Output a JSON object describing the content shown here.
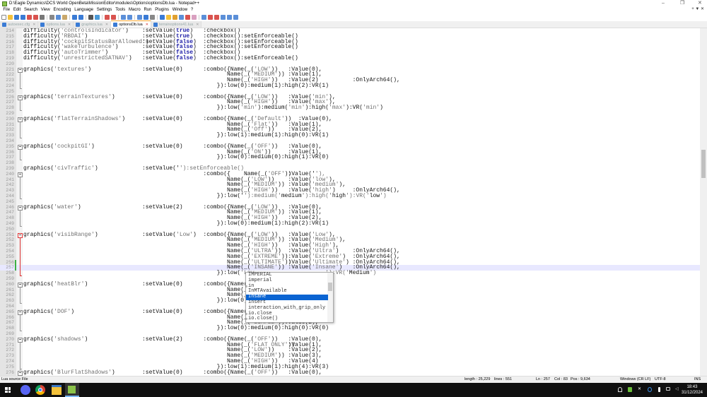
{
  "window": {
    "title": "D:\\Eagle Dynamics\\DCS World OpenBeta\\MissionEditor\\modules\\Options\\optionsDb.lua - Notepad++",
    "minimize": "–",
    "restore": "❐",
    "close": "✕"
  },
  "menu": [
    "File",
    "Edit",
    "Search",
    "View",
    "Encoding",
    "Language",
    "Settings",
    "Tools",
    "Macro",
    "Run",
    "Plugins",
    "Window",
    "?"
  ],
  "menu_right": "+ ▼ ✕",
  "tabs": [
    {
      "label": "autoexec.cfg",
      "active": false
    },
    {
      "label": "options.lua",
      "active": false
    },
    {
      "label": "graphics.lua",
      "active": false
    },
    {
      "label": "optionsDb.lua",
      "active": true
    },
    {
      "label": "terrainoptions41.lua",
      "active": false
    }
  ],
  "lines": [
    {
      "n": "214",
      "a": "difficulty('controlsIndicator')",
      "b": ":setValue(true)",
      "c": ":checkbox()"
    },
    {
      "n": "215",
      "a": "difficulty('RBDAI')",
      "b": ":setValue(true)",
      "c": ":checkbox():setEnforceable()"
    },
    {
      "n": "216",
      "a": "difficulty('cockpitStatusBarAllowed')",
      "b": ":setValue(false)",
      "c": ":checkbox():setEnforceable()"
    },
    {
      "n": "217",
      "a": "difficulty('wakeTurbulence')",
      "b": ":setValue(false)",
      "c": ":checkbox():setEnforceable()"
    },
    {
      "n": "218",
      "a": "difficulty('autoTrimmer')",
      "b": ":setValue(false)",
      "c": ":checkbox()"
    },
    {
      "n": "219",
      "a": "difficulty('unrestrictedSATNAV')",
      "b": ":setValue(false)",
      "c": ":checkbox():setEnforceable()"
    },
    {
      "n": "220"
    },
    {
      "n": "221",
      "fold": "s",
      "a": "graphics('textures')",
      "b": ":setValue(0)",
      "c": ":combo({Name(_('LOW'))",
      "f": ":Value(0),"
    },
    {
      "n": "222",
      "fold": "m",
      "e": "Name(_('MEDIUM'))",
      "f": ":Value(1),"
    },
    {
      "n": "223",
      "fold": "m",
      "e": "Name(_('HIGH'))",
      "f": ":Value(2)",
      "g": ":OnlyArch64(),"
    },
    {
      "n": "224",
      "fold": "e",
      "d": "}):low(0):medium(1):high(2):VR(1)"
    },
    {
      "n": "225"
    },
    {
      "n": "226",
      "fold": "s",
      "a": "graphics('terrainTextures')",
      "b": ":setValue(0)",
      "c": ":combo({Name(_('LOW'))",
      "f": ":Value('min'),"
    },
    {
      "n": "227",
      "fold": "m",
      "e": "Name(_('HIGH'))",
      "f": ":Value('max'),"
    },
    {
      "n": "228",
      "fold": "e",
      "d": "}):low('min'):medium('min'):high('max'):VR('min')"
    },
    {
      "n": "229"
    },
    {
      "n": "230",
      "fold": "s",
      "a": "graphics('flatTerrainShadows')",
      "b": ":setValue(0)",
      "c": ":combo({Name(_('Default'))  :Value(0),"
    },
    {
      "n": "231",
      "fold": "m",
      "e": "Name(_('Flat'))",
      "f": ":Value(1),"
    },
    {
      "n": "232",
      "fold": "m",
      "e": "Name(_('Off'))",
      "f": ":Value(2),"
    },
    {
      "n": "233",
      "fold": "e",
      "d": "}):low(1):medium(1):high(0):VR(1)"
    },
    {
      "n": "234"
    },
    {
      "n": "235",
      "fold": "s",
      "a": "graphics('cockpitGI')",
      "b": ":setValue(0)",
      "c": ":combo({Name(_('OFF'))",
      "f": ":Value(0),"
    },
    {
      "n": "236",
      "fold": "m",
      "e": "Name(_('ON'))",
      "f": ":Value(1),"
    },
    {
      "n": "237",
      "fold": "e",
      "d": "}):low(0):medium(0):high(1):VR(0)"
    },
    {
      "n": "238"
    },
    {
      "n": "239",
      "a": "graphics('civTraffic')",
      "b": ":setValue(''):setEnforceable()"
    },
    {
      "n": "240",
      "fold": "s",
      "c": ":combo({    Name(_('OFF'))",
      "f": ":Value(''),"
    },
    {
      "n": "241",
      "fold": "m",
      "e": "Name(_('LOW'))",
      "f": ":Value('low'),"
    },
    {
      "n": "242",
      "fold": "m",
      "e": "Name(_('MEDIUM'))",
      "f": ":Value('medium'),"
    },
    {
      "n": "243",
      "fold": "m",
      "e": "Name(_('HIGH'))",
      "f": ":Value('high')",
      "g": ":OnlyArch64(),"
    },
    {
      "n": "244",
      "fold": "e",
      "d": "}):low(''):medium('medium'):high('high'):VR('low')"
    },
    {
      "n": "245"
    },
    {
      "n": "246",
      "fold": "s",
      "a": "graphics('water')",
      "b": ":setValue(2)",
      "c": ":combo({Name(_('LOW'))",
      "f": ":Value(0),"
    },
    {
      "n": "247",
      "fold": "m",
      "e": "Name(_('MEDIUM'))",
      "f": ":Value(1),"
    },
    {
      "n": "248",
      "fold": "m",
      "e": "Name(_('HIGH'))",
      "f": ":Value(2),"
    },
    {
      "n": "249",
      "fold": "e",
      "d": "}):low(0):medium(1):high(2):VR(1)"
    },
    {
      "n": "250"
    },
    {
      "n": "251",
      "fold": "s",
      "red": true,
      "a": "graphics('visibRange')",
      "b": ":setValue('Low')",
      "c": ":combo({Name(_('LOW'))",
      "f": ":Value('Low'),"
    },
    {
      "n": "252",
      "fold": "m",
      "red": true,
      "e": "Name(_('MEDIUM'))",
      "f": ":Value('Medium'),"
    },
    {
      "n": "253",
      "fold": "m",
      "red": true,
      "e": "Name(_('HIGH'))",
      "f": ":Value('High'),"
    },
    {
      "n": "254",
      "fold": "m",
      "red": true,
      "e": "Name(_('ULTRA'))",
      "f": ":Value('Ultra')",
      "g": ":OnlyArch64(),"
    },
    {
      "n": "255",
      "fold": "m",
      "red": true,
      "e": "Name(_('EXTREME'))",
      "f": ":Value('Extreme')",
      "g": ":OnlyArch64(),"
    },
    {
      "n": "256",
      "fold": "m",
      "red": true,
      "changed": true,
      "e": "Name(_('ULTIMATE'))",
      "f": ":Value('Ultimate')",
      "g": ":OnlyArch64(),"
    },
    {
      "n": "257",
      "fold": "m",
      "red": true,
      "changed": true,
      "current": true,
      "e": "Name(_('INSANE'))",
      "f": ":Value('Insane')",
      "g": ":OnlyArch64(),"
    },
    {
      "n": "258",
      "fold": "e",
      "red": true,
      "d": "}):low('Low",
      "h": "'):VR('Medium')"
    },
    {
      "n": "259"
    },
    {
      "n": "260",
      "fold": "s",
      "a": "graphics('heatBlr')",
      "b": ":setValue(0)",
      "c": ":combo({Name(_("
    },
    {
      "n": "261",
      "fold": "m",
      "e": "Name(_("
    },
    {
      "n": "262",
      "fold": "m",
      "e": "Name(_("
    },
    {
      "n": "263",
      "fold": "e",
      "d": "}):low(0):m"
    },
    {
      "n": "264"
    },
    {
      "n": "265",
      "fold": "s",
      "a": "graphics('DOF')",
      "b": ":setValue(0)",
      "c": ":combo({Name(_("
    },
    {
      "n": "266",
      "fold": "m",
      "e": "Name(_("
    },
    {
      "n": "267",
      "fold": "m",
      "e": "Name(_('SIMPLE')):Value(2),"
    },
    {
      "n": "268",
      "fold": "e",
      "d": "}):low(0):medium(0):high(0):VR(0)"
    },
    {
      "n": "269"
    },
    {
      "n": "270",
      "fold": "s",
      "a": "graphics('shadows')",
      "b": ":setValue(2)",
      "c": ":combo({Name(_('OFF'))",
      "f": ":Value(0),"
    },
    {
      "n": "271",
      "fold": "m",
      "e": "Name(_('FLAT ONLY'))",
      "f": ":Value(1),"
    },
    {
      "n": "272",
      "fold": "m",
      "e": "Name(_('LOW'))",
      "f": ":Value(2),"
    },
    {
      "n": "273",
      "fold": "m",
      "e": "Name(_('MEDIUM'))",
      "f": ":Value(3),"
    },
    {
      "n": "274",
      "fold": "m",
      "e": "Name(_('HIGH'))",
      "f": ":Value(4)"
    },
    {
      "n": "275",
      "fold": "e",
      "d": "}):low(1):medium(1):high(4):VR(3)"
    },
    {
      "n": "276",
      "fold": "s",
      "a": "graphics('BlurFlatShadows')",
      "b": ":setValue(0)",
      "c": ":combo({Name(_('OFF'))",
      "f": ":Value(0),"
    }
  ],
  "autocomplete": {
    "items": [
      "IMPERIAL",
      "imperial",
      "in",
      "InMTAvailable",
      "Insane",
      "insert",
      "interaction_with_grip_only",
      "io.close",
      "io.close()"
    ],
    "selected": 4
  },
  "status": {
    "filetype": "Lua source File",
    "length": "length : 25,229",
    "lines": "lines : 551",
    "ln": "Ln : 257",
    "col": "Col : 83",
    "pos": "Pos : 9,634",
    "eol": "Windows (CR LF)",
    "encoding": "UTF-8",
    "mode": "INS"
  },
  "taskbar": {
    "time": "18:43",
    "date": "31/12/2024"
  },
  "colors": {
    "accent": "#f8a530",
    "selection": "#0a64d2",
    "current_line": "#e8e8ff"
  }
}
